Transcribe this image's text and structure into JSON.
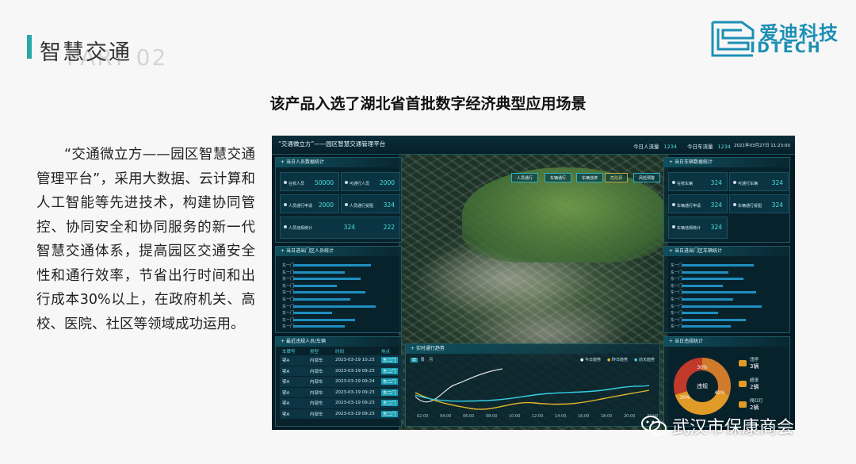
{
  "slide": {
    "section_title": "智慧交通",
    "section_sub": "PART 02",
    "headline": "该产品入选了湖北省首批数字经济典型应用场景",
    "body": "“交通微立方——园区智慧交通管理平台”，采用大数据、云计算和人工智能等先进技术，构建协同管控、协同安全和协同服务的新一代智慧交通体系，提高园区交通安全性和通行效率，节省出行时间和出行成本30%以上，在政府机关、高校、医院、社区等领域成功运用。",
    "accent_color": "#2aa7a7"
  },
  "logo": {
    "cn": "爱迪科技",
    "en": "IDTECH",
    "icon": "idtech-logo-icon"
  },
  "watermark": {
    "text": "武汉市保康商会",
    "icon": "wechat-icon"
  },
  "dashboard": {
    "title": "“交通微立方”——园区智慧交通管理平台",
    "stats": [
      {
        "label": "今日人流量",
        "value": "1234"
      },
      {
        "label": "今日车流量",
        "value": "1234"
      }
    ],
    "time": "2021年03月27日 11:23:00",
    "map_buttons": [
      "人员通行",
      "车辆通行",
      "车辆违停",
      "危险源",
      "风险预警"
    ],
    "people_panel": {
      "title": "当日人员数据统计",
      "cards": [
        {
          "label": "在校人员",
          "value": "50000"
        },
        {
          "label": "可通行人员",
          "value": "2000"
        },
        {
          "label": "人员通行申请",
          "value": "2000"
        },
        {
          "label": "人员通行受阻",
          "value": "324"
        },
        {
          "label": "人员违规统计",
          "value": "324"
        },
        {
          "label": "",
          "value": "222"
        }
      ]
    },
    "vehicle_panel": {
      "title": "当日车辆数据统计",
      "cards": [
        {
          "label": "在校车辆",
          "value": "324"
        },
        {
          "label": "可通行车辆",
          "value": "324"
        },
        {
          "label": "车辆通行申请",
          "value": "324"
        },
        {
          "label": "车辆通行受阻",
          "value": "324"
        },
        {
          "label": "车辆违规统计",
          "value": "324"
        }
      ]
    },
    "people_gate_panel": {
      "title": "当日进出门区人员统计",
      "rows": [
        "东一门",
        "东一门",
        "东一门",
        "东一门",
        "东一门",
        "东一门",
        "东一门",
        "东一门",
        "东一门",
        "东一门"
      ],
      "values": [
        0.75,
        0.5,
        0.65,
        0.42,
        0.7,
        0.55,
        0.8,
        0.38,
        0.6,
        0.5
      ]
    },
    "vehicle_gate_panel": {
      "title": "当日进出门区车辆统计",
      "rows": [
        "东一门",
        "东一门",
        "东一门",
        "东一门",
        "东一门",
        "东一门",
        "东一门",
        "东一门",
        "东一门",
        "东一门"
      ],
      "values": [
        0.7,
        0.45,
        0.6,
        0.4,
        0.72,
        0.5,
        0.78,
        0.35,
        0.62,
        0.48
      ]
    },
    "violation_panel": {
      "title": "最近违规人员/车辆",
      "headers": [
        "车牌号",
        "类型",
        "时间",
        "地点"
      ],
      "rows": [
        {
          "plate": "鄂A",
          "type": "内部车",
          "time": "2023-03-19 10:23",
          "gate": "东二门"
        },
        {
          "plate": "鄂A",
          "type": "内部车",
          "time": "2023-03-19 09:23",
          "gate": "东二门"
        },
        {
          "plate": "鄂A",
          "type": "内部车",
          "time": "2023-03-19 09:24",
          "gate": "东二门"
        },
        {
          "plate": "鄂A",
          "type": "内部车",
          "time": "2023-03-19 09:23",
          "gate": "东二门"
        },
        {
          "plate": "鄂A",
          "type": "内部车",
          "time": "2023-03-19 09:23",
          "gate": "东二门"
        },
        {
          "plate": "鄂A",
          "type": "内部车",
          "time": "2023-03-19 09:23",
          "gate": "东二门"
        }
      ]
    },
    "trend_panel": {
      "title": "实时通行趋势",
      "tabs": [
        "日",
        "周",
        "月"
      ],
      "legend": [
        "今日趋势",
        "昨日趋势",
        "前天趋势"
      ],
      "x_labels": [
        "02:00",
        "04:00",
        "06:00",
        "08:00",
        "10:00",
        "12:00",
        "14:00",
        "16:00",
        "18:00",
        "20:00",
        "22:00"
      ]
    },
    "stats_panel": {
      "title": "当日违规统计",
      "donut_center": "违规",
      "slices": [
        {
          "label": "30%",
          "value": 30,
          "color": "#d07a2b"
        },
        {
          "label": "40%",
          "value": 40,
          "color": "#e09a28"
        },
        {
          "label": "30%",
          "value": 30,
          "color": "#c0392b"
        }
      ],
      "items": [
        {
          "label": "违停",
          "value": "3辆"
        },
        {
          "label": "超速",
          "value": "2辆"
        },
        {
          "label": "闯红灯",
          "value": "2辆"
        }
      ]
    }
  }
}
